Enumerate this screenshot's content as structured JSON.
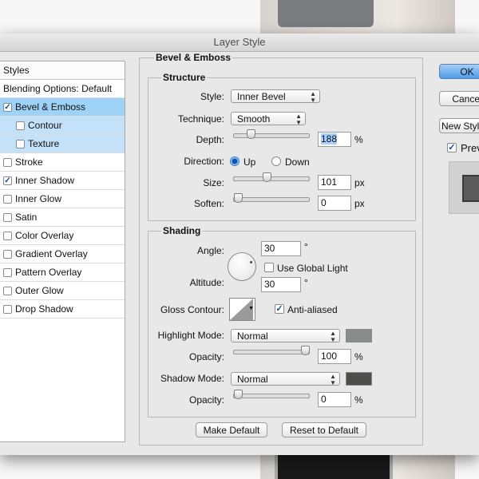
{
  "window": {
    "title": "Layer Style"
  },
  "styles_panel": {
    "header": "Styles",
    "items": [
      {
        "label": "Blending Options: Default",
        "checkbox": false,
        "checked": false,
        "indent": false,
        "state": "normal"
      },
      {
        "label": "Bevel & Emboss",
        "checkbox": true,
        "checked": true,
        "indent": false,
        "state": "selected"
      },
      {
        "label": "Contour",
        "checkbox": true,
        "checked": false,
        "indent": true,
        "state": "sub"
      },
      {
        "label": "Texture",
        "checkbox": true,
        "checked": false,
        "indent": true,
        "state": "sub"
      },
      {
        "label": "Stroke",
        "checkbox": true,
        "checked": false,
        "indent": false,
        "state": "normal"
      },
      {
        "label": "Inner Shadow",
        "checkbox": true,
        "checked": true,
        "indent": false,
        "state": "normal"
      },
      {
        "label": "Inner Glow",
        "checkbox": true,
        "checked": false,
        "indent": false,
        "state": "normal"
      },
      {
        "label": "Satin",
        "checkbox": true,
        "checked": false,
        "indent": false,
        "state": "normal"
      },
      {
        "label": "Color Overlay",
        "checkbox": true,
        "checked": false,
        "indent": false,
        "state": "normal"
      },
      {
        "label": "Gradient Overlay",
        "checkbox": true,
        "checked": false,
        "indent": false,
        "state": "normal"
      },
      {
        "label": "Pattern Overlay",
        "checkbox": true,
        "checked": false,
        "indent": false,
        "state": "normal"
      },
      {
        "label": "Outer Glow",
        "checkbox": true,
        "checked": false,
        "indent": false,
        "state": "normal"
      },
      {
        "label": "Drop Shadow",
        "checkbox": true,
        "checked": false,
        "indent": false,
        "state": "normal"
      }
    ]
  },
  "bevel": {
    "title": "Bevel & Emboss",
    "structure": {
      "title": "Structure",
      "style_label": "Style:",
      "style_value": "Inner Bevel",
      "technique_label": "Technique:",
      "technique_value": "Smooth",
      "depth_label": "Depth:",
      "depth_value": "188",
      "depth_unit": "%",
      "depth_slider": 0.19,
      "direction_label": "Direction:",
      "dir_up": "Up",
      "dir_down": "Down",
      "size_label": "Size:",
      "size_value": "101",
      "size_unit": "px",
      "size_slider": 0.43,
      "soften_label": "Soften:",
      "soften_value": "0",
      "soften_unit": "px",
      "soften_slider": 0.0
    },
    "shading": {
      "title": "Shading",
      "angle_label": "Angle:",
      "angle_value": "30",
      "degree": "°",
      "global_light": "Use Global Light",
      "altitude_label": "Altitude:",
      "altitude_value": "30",
      "gloss_label": "Gloss Contour:",
      "anti_aliased": "Anti-aliased",
      "highlight_label": "Highlight Mode:",
      "highlight_mode": "Normal",
      "highlight_color": "#8a8b8b",
      "opacity_label": "Opacity:",
      "highlight_opacity": "100",
      "highlight_opacity_slider": 1.0,
      "shadow_label": "Shadow Mode:",
      "shadow_mode": "Normal",
      "shadow_color": "#4e4f4a",
      "shadow_opacity": "0",
      "shadow_opacity_slider": 0.0,
      "percent": "%"
    }
  },
  "buttons": {
    "make_default": "Make Default",
    "reset_default": "Reset to Default",
    "ok": "OK",
    "cancel": "Cancel",
    "new_style": "New Style...",
    "preview": "Preview"
  },
  "colors": {
    "selected_row": "#9fd2f7",
    "ok_button": "#4f9ae8"
  }
}
